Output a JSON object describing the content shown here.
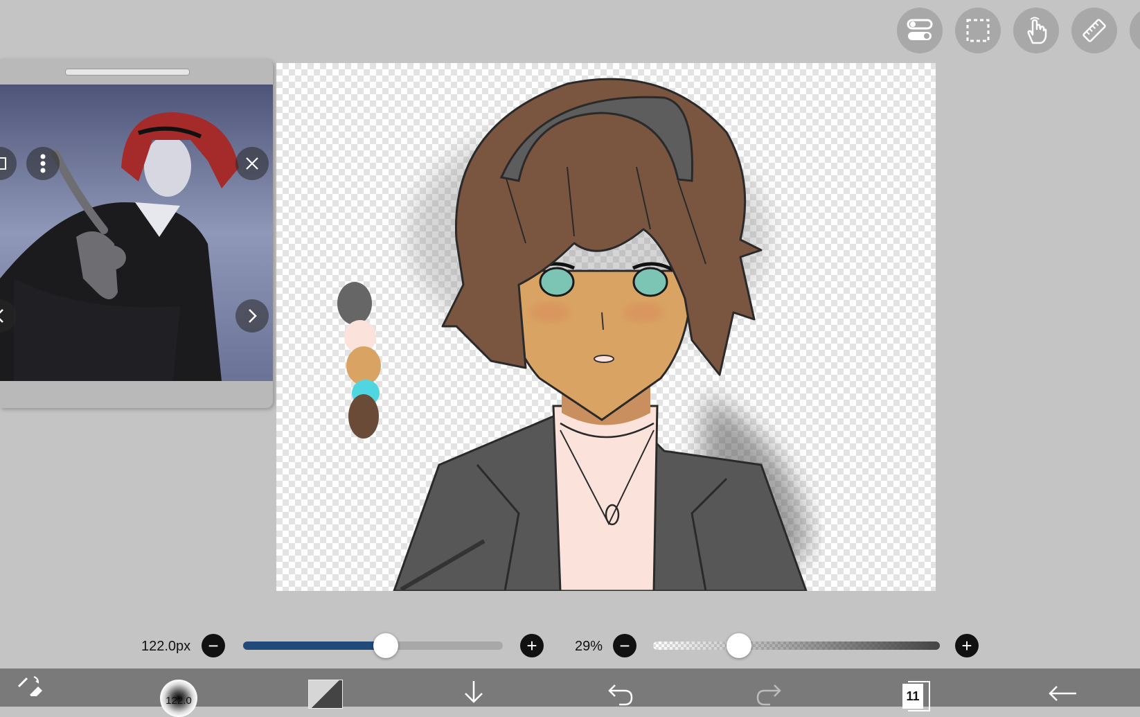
{
  "brush": {
    "size_label": "122.0px",
    "size_value_fraction": 0.55,
    "thumbnail_label": "122.0"
  },
  "opacity": {
    "label": "29%",
    "value_fraction": 0.3
  },
  "layers": {
    "count": "11"
  },
  "colors": {
    "accent_slider": "#1f4a7a",
    "palette_swatches": [
      "#666666",
      "#fbe3dc",
      "#d9a363",
      "#4fd6e0",
      "#6a4b38"
    ]
  },
  "icons": {
    "top_toolbar": [
      "toggle-icon",
      "selection-icon",
      "hand-icon",
      "ruler-icon"
    ],
    "bottom_toolbar": [
      "tool-switch-icon",
      "brush-icon",
      "color-icon",
      "download-icon",
      "undo-icon",
      "redo-icon",
      "layers-icon",
      "back-icon"
    ]
  }
}
